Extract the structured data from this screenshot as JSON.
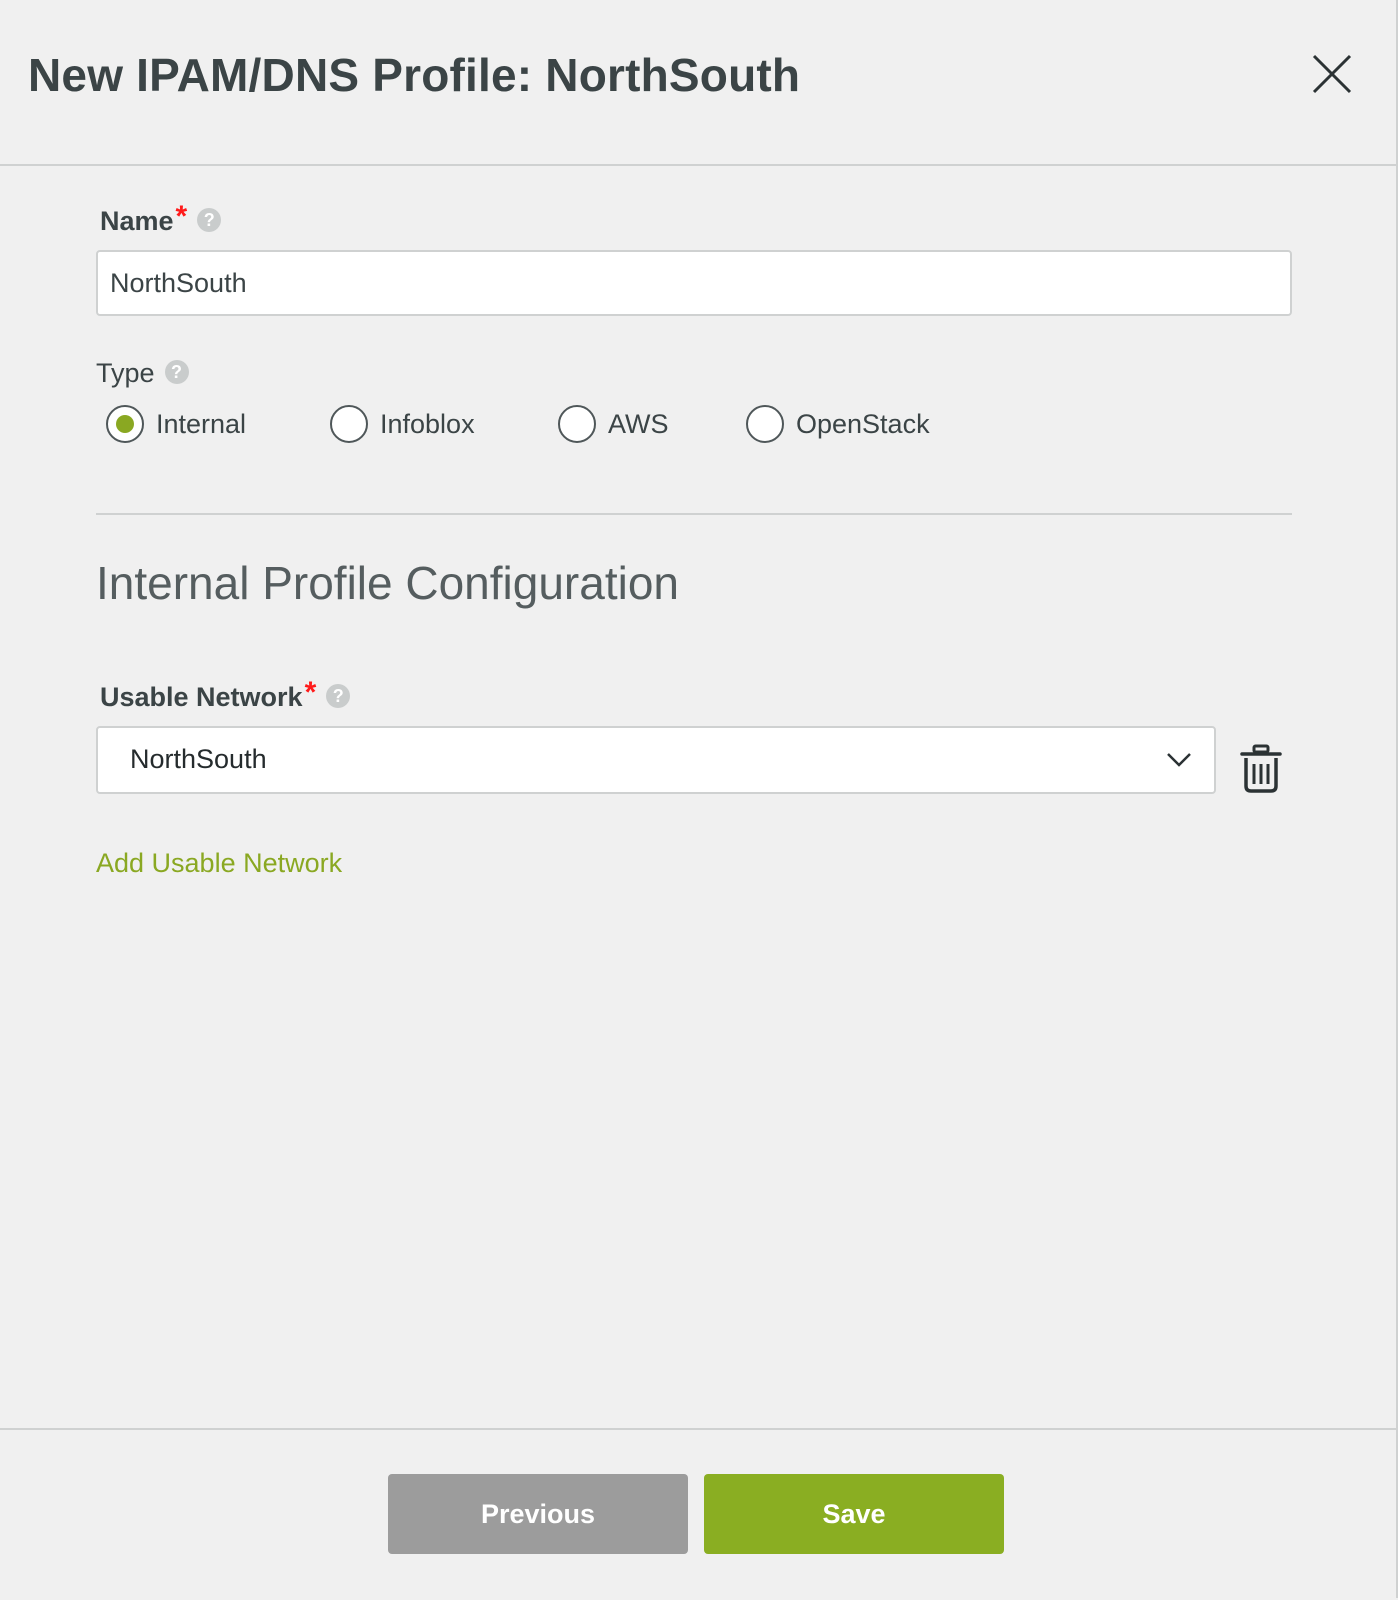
{
  "dialog": {
    "title": "New IPAM/DNS Profile: NorthSouth"
  },
  "name_field": {
    "label": "Name",
    "required_mark": "*",
    "help": "?",
    "value": "NorthSouth"
  },
  "type_field": {
    "label": "Type",
    "help": "?",
    "options": [
      {
        "label": "Internal",
        "selected": true
      },
      {
        "label": "Infoblox",
        "selected": false
      },
      {
        "label": "AWS",
        "selected": false
      },
      {
        "label": "OpenStack",
        "selected": false
      }
    ]
  },
  "section": {
    "title": "Internal Profile Configuration"
  },
  "usable_network": {
    "label": "Usable Network",
    "required_mark": "*",
    "help": "?",
    "selected_value": "NorthSouth",
    "add_link": "Add Usable Network"
  },
  "footer": {
    "previous_label": "Previous",
    "save_label": "Save"
  },
  "colors": {
    "accent_green": "#8aae22",
    "required_red": "#ff1a1a",
    "previous_gray": "#9c9c9c"
  },
  "icons": [
    "close-icon",
    "help-icon",
    "chevron-down-icon",
    "trash-icon"
  ]
}
